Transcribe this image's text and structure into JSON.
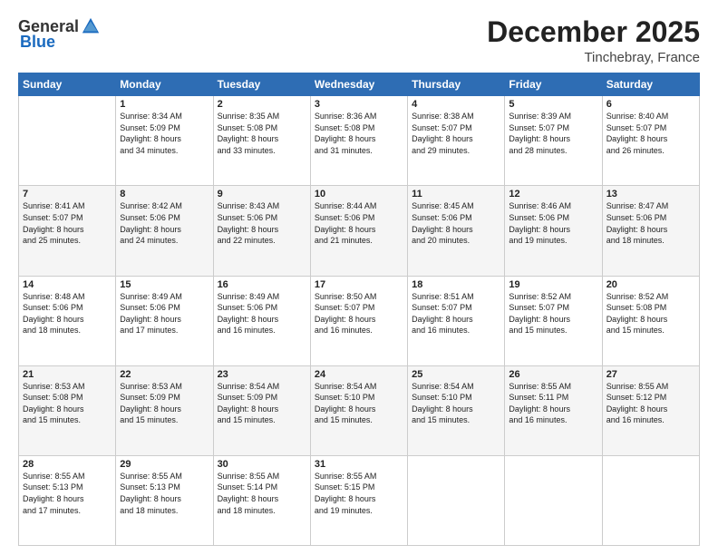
{
  "header": {
    "logo_general": "General",
    "logo_blue": "Blue",
    "main_title": "December 2025",
    "subtitle": "Tinchebray, France"
  },
  "calendar": {
    "days_of_week": [
      "Sunday",
      "Monday",
      "Tuesday",
      "Wednesday",
      "Thursday",
      "Friday",
      "Saturday"
    ],
    "weeks": [
      [
        {
          "day": "",
          "info": ""
        },
        {
          "day": "1",
          "info": "Sunrise: 8:34 AM\nSunset: 5:09 PM\nDaylight: 8 hours\nand 34 minutes."
        },
        {
          "day": "2",
          "info": "Sunrise: 8:35 AM\nSunset: 5:08 PM\nDaylight: 8 hours\nand 33 minutes."
        },
        {
          "day": "3",
          "info": "Sunrise: 8:36 AM\nSunset: 5:08 PM\nDaylight: 8 hours\nand 31 minutes."
        },
        {
          "day": "4",
          "info": "Sunrise: 8:38 AM\nSunset: 5:07 PM\nDaylight: 8 hours\nand 29 minutes."
        },
        {
          "day": "5",
          "info": "Sunrise: 8:39 AM\nSunset: 5:07 PM\nDaylight: 8 hours\nand 28 minutes."
        },
        {
          "day": "6",
          "info": "Sunrise: 8:40 AM\nSunset: 5:07 PM\nDaylight: 8 hours\nand 26 minutes."
        }
      ],
      [
        {
          "day": "7",
          "info": "Sunrise: 8:41 AM\nSunset: 5:07 PM\nDaylight: 8 hours\nand 25 minutes."
        },
        {
          "day": "8",
          "info": "Sunrise: 8:42 AM\nSunset: 5:06 PM\nDaylight: 8 hours\nand 24 minutes."
        },
        {
          "day": "9",
          "info": "Sunrise: 8:43 AM\nSunset: 5:06 PM\nDaylight: 8 hours\nand 22 minutes."
        },
        {
          "day": "10",
          "info": "Sunrise: 8:44 AM\nSunset: 5:06 PM\nDaylight: 8 hours\nand 21 minutes."
        },
        {
          "day": "11",
          "info": "Sunrise: 8:45 AM\nSunset: 5:06 PM\nDaylight: 8 hours\nand 20 minutes."
        },
        {
          "day": "12",
          "info": "Sunrise: 8:46 AM\nSunset: 5:06 PM\nDaylight: 8 hours\nand 19 minutes."
        },
        {
          "day": "13",
          "info": "Sunrise: 8:47 AM\nSunset: 5:06 PM\nDaylight: 8 hours\nand 18 minutes."
        }
      ],
      [
        {
          "day": "14",
          "info": "Sunrise: 8:48 AM\nSunset: 5:06 PM\nDaylight: 8 hours\nand 18 minutes."
        },
        {
          "day": "15",
          "info": "Sunrise: 8:49 AM\nSunset: 5:06 PM\nDaylight: 8 hours\nand 17 minutes."
        },
        {
          "day": "16",
          "info": "Sunrise: 8:49 AM\nSunset: 5:06 PM\nDaylight: 8 hours\nand 16 minutes."
        },
        {
          "day": "17",
          "info": "Sunrise: 8:50 AM\nSunset: 5:07 PM\nDaylight: 8 hours\nand 16 minutes."
        },
        {
          "day": "18",
          "info": "Sunrise: 8:51 AM\nSunset: 5:07 PM\nDaylight: 8 hours\nand 16 minutes."
        },
        {
          "day": "19",
          "info": "Sunrise: 8:52 AM\nSunset: 5:07 PM\nDaylight: 8 hours\nand 15 minutes."
        },
        {
          "day": "20",
          "info": "Sunrise: 8:52 AM\nSunset: 5:08 PM\nDaylight: 8 hours\nand 15 minutes."
        }
      ],
      [
        {
          "day": "21",
          "info": "Sunrise: 8:53 AM\nSunset: 5:08 PM\nDaylight: 8 hours\nand 15 minutes."
        },
        {
          "day": "22",
          "info": "Sunrise: 8:53 AM\nSunset: 5:09 PM\nDaylight: 8 hours\nand 15 minutes."
        },
        {
          "day": "23",
          "info": "Sunrise: 8:54 AM\nSunset: 5:09 PM\nDaylight: 8 hours\nand 15 minutes."
        },
        {
          "day": "24",
          "info": "Sunrise: 8:54 AM\nSunset: 5:10 PM\nDaylight: 8 hours\nand 15 minutes."
        },
        {
          "day": "25",
          "info": "Sunrise: 8:54 AM\nSunset: 5:10 PM\nDaylight: 8 hours\nand 15 minutes."
        },
        {
          "day": "26",
          "info": "Sunrise: 8:55 AM\nSunset: 5:11 PM\nDaylight: 8 hours\nand 16 minutes."
        },
        {
          "day": "27",
          "info": "Sunrise: 8:55 AM\nSunset: 5:12 PM\nDaylight: 8 hours\nand 16 minutes."
        }
      ],
      [
        {
          "day": "28",
          "info": "Sunrise: 8:55 AM\nSunset: 5:13 PM\nDaylight: 8 hours\nand 17 minutes."
        },
        {
          "day": "29",
          "info": "Sunrise: 8:55 AM\nSunset: 5:13 PM\nDaylight: 8 hours\nand 18 minutes."
        },
        {
          "day": "30",
          "info": "Sunrise: 8:55 AM\nSunset: 5:14 PM\nDaylight: 8 hours\nand 18 minutes."
        },
        {
          "day": "31",
          "info": "Sunrise: 8:55 AM\nSunset: 5:15 PM\nDaylight: 8 hours\nand 19 minutes."
        },
        {
          "day": "",
          "info": ""
        },
        {
          "day": "",
          "info": ""
        },
        {
          "day": "",
          "info": ""
        }
      ]
    ]
  }
}
